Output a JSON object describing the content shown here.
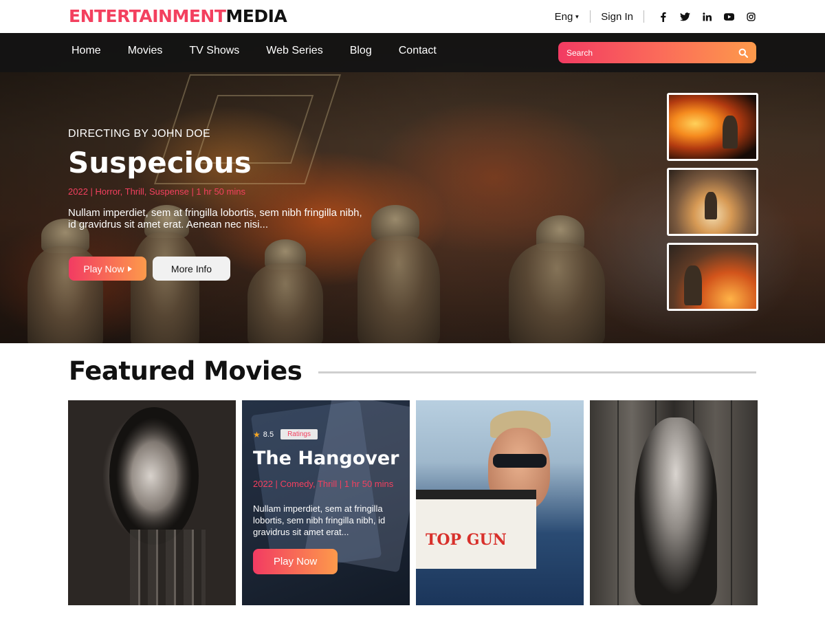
{
  "brand": {
    "part1": "ENTERTAINMENT",
    "part2": "MEDIA"
  },
  "topbar": {
    "language": "Eng",
    "sign_in": "Sign In",
    "socials": [
      "facebook-icon",
      "twitter-icon",
      "linkedin-icon",
      "youtube-icon",
      "instagram-icon"
    ]
  },
  "nav": {
    "items": [
      "Home",
      "Movies",
      "TV Shows",
      "Web Series",
      "Blog",
      "Contact"
    ]
  },
  "search": {
    "placeholder": "Search"
  },
  "hero": {
    "director": "DIRECTING BY JOHN DOE",
    "title": "Suspecious",
    "meta": "2022 | Horror, Thrill, Suspense | 1 hr 50 mins",
    "description": "Nullam imperdiet, sem at fringilla lobortis, sem nibh fringilla nibh, id gravidrus sit amet erat. Aenean nec nisi...",
    "play_label": "Play Now",
    "info_label": "More Info"
  },
  "featured": {
    "heading": "Featured Movies",
    "highlight": {
      "rating": "8.5",
      "rating_label": "Ratings",
      "title": "The Hangover",
      "meta": "2022 | Comedy, Thrill | 1 hr 50 mins",
      "description": "Nullam imperdiet, sem at fringilla lobortis, sem nibh fringilla nibh, id gravidrus sit amet erat...",
      "play_label": "Play Now"
    },
    "poster3_text": "TOP GUN"
  },
  "colors": {
    "accent": "#f3405f",
    "accent_end": "#fd9a4b",
    "dark": "#111111"
  }
}
